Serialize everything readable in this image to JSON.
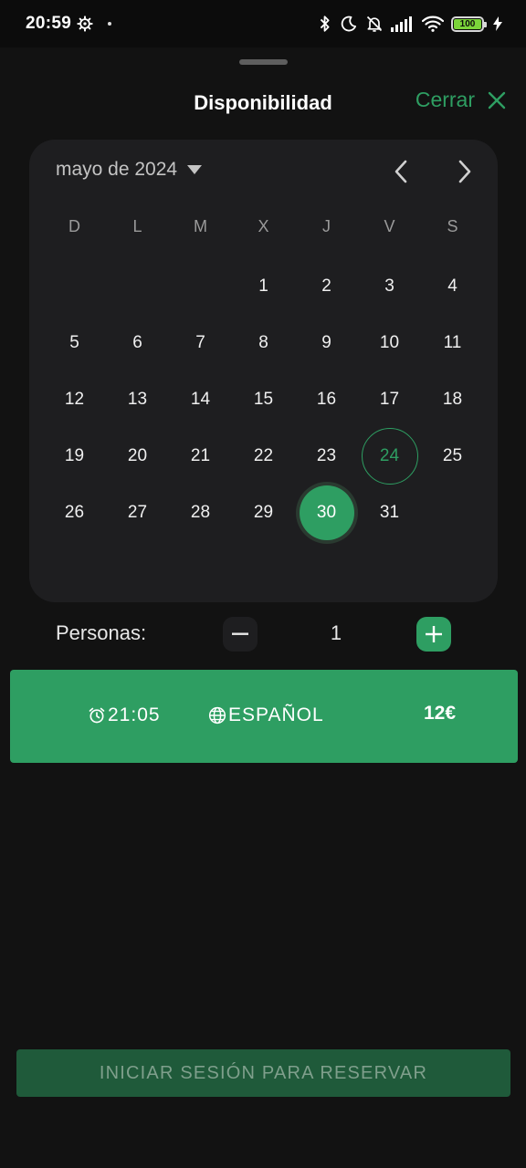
{
  "status_bar": {
    "time": "20:59",
    "battery": "100",
    "icons": [
      "settings-gear-icon",
      "bluetooth-icon",
      "moon-icon",
      "bell-off-icon",
      "signal-icon",
      "wifi-icon",
      "battery-icon",
      "charging-bolt-icon"
    ]
  },
  "header": {
    "title": "Disponibilidad",
    "close_label": "Cerrar"
  },
  "calendar": {
    "month_label": "mayo de 2024",
    "weekdays": [
      "D",
      "L",
      "M",
      "X",
      "J",
      "V",
      "S"
    ],
    "days": [
      "",
      "",
      "",
      "1",
      "2",
      "3",
      "4",
      "5",
      "6",
      "7",
      "8",
      "9",
      "10",
      "11",
      "12",
      "13",
      "14",
      "15",
      "16",
      "17",
      "18",
      "19",
      "20",
      "21",
      "22",
      "23",
      "24",
      "25",
      "26",
      "27",
      "28",
      "29",
      "30",
      "31",
      ""
    ],
    "today": "24",
    "selected": "30"
  },
  "persons": {
    "label": "Personas:",
    "count": "1"
  },
  "slot": {
    "time": "21:05",
    "language": "ESPAÑOL",
    "price": "12€"
  },
  "reserve": {
    "label": "INICIAR SESIÓN PARA RESERVAR"
  },
  "colors": {
    "accent": "#2e9e62",
    "background": "#121212",
    "card": "#1e1e20",
    "disabled_button": "#1f5a3a"
  }
}
